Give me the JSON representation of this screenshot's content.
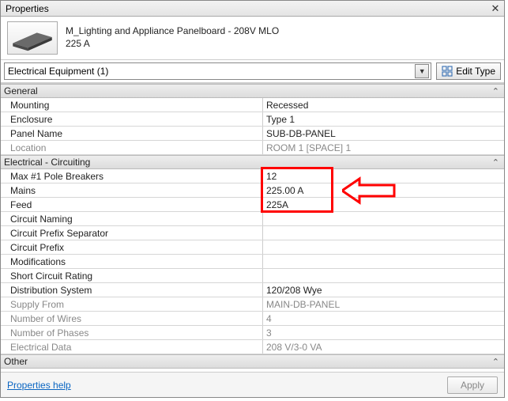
{
  "window": {
    "title": "Properties"
  },
  "header": {
    "title": "M_Lighting and Appliance Panelboard - 208V MLO",
    "subtitle": "225 A"
  },
  "selector": {
    "label": "Electrical Equipment (1)"
  },
  "editType": {
    "label": "Edit Type"
  },
  "sections": {
    "general": {
      "title": "General",
      "rows": [
        {
          "label": "Mounting",
          "value": "Recessed",
          "disabled": false
        },
        {
          "label": "Enclosure",
          "value": "Type 1",
          "disabled": false
        },
        {
          "label": "Panel Name",
          "value": "SUB-DB-PANEL",
          "disabled": false
        },
        {
          "label": "Location",
          "value": "ROOM 1 [SPACE] 1",
          "disabled": true
        }
      ]
    },
    "circuiting": {
      "title": "Electrical - Circuiting",
      "rows": [
        {
          "label": "Max #1 Pole Breakers",
          "value": "12",
          "disabled": false
        },
        {
          "label": "Mains",
          "value": "225.00 A",
          "disabled": false
        },
        {
          "label": "Feed",
          "value": "225A",
          "disabled": false
        },
        {
          "label": "Circuit Naming",
          "value": "",
          "disabled": false
        },
        {
          "label": "Circuit Prefix Separator",
          "value": "",
          "disabled": false
        },
        {
          "label": "Circuit Prefix",
          "value": "",
          "disabled": false
        },
        {
          "label": "Modifications",
          "value": "",
          "disabled": false
        },
        {
          "label": "Short Circuit Rating",
          "value": "",
          "disabled": false
        },
        {
          "label": "Distribution System",
          "value": "120/208 Wye",
          "disabled": false
        },
        {
          "label": "Supply From",
          "value": "MAIN-DB-PANEL",
          "disabled": true
        },
        {
          "label": "Number of Wires",
          "value": "4",
          "disabled": true
        },
        {
          "label": "Number of Phases",
          "value": "3",
          "disabled": true
        },
        {
          "label": "Electrical Data",
          "value": "208 V/3-0 VA",
          "disabled": true
        }
      ]
    },
    "other": {
      "title": "Other"
    }
  },
  "footer": {
    "help": "Properties help",
    "apply": "Apply"
  },
  "annotation": {
    "highlight_rows": [
      0,
      1,
      2
    ]
  }
}
